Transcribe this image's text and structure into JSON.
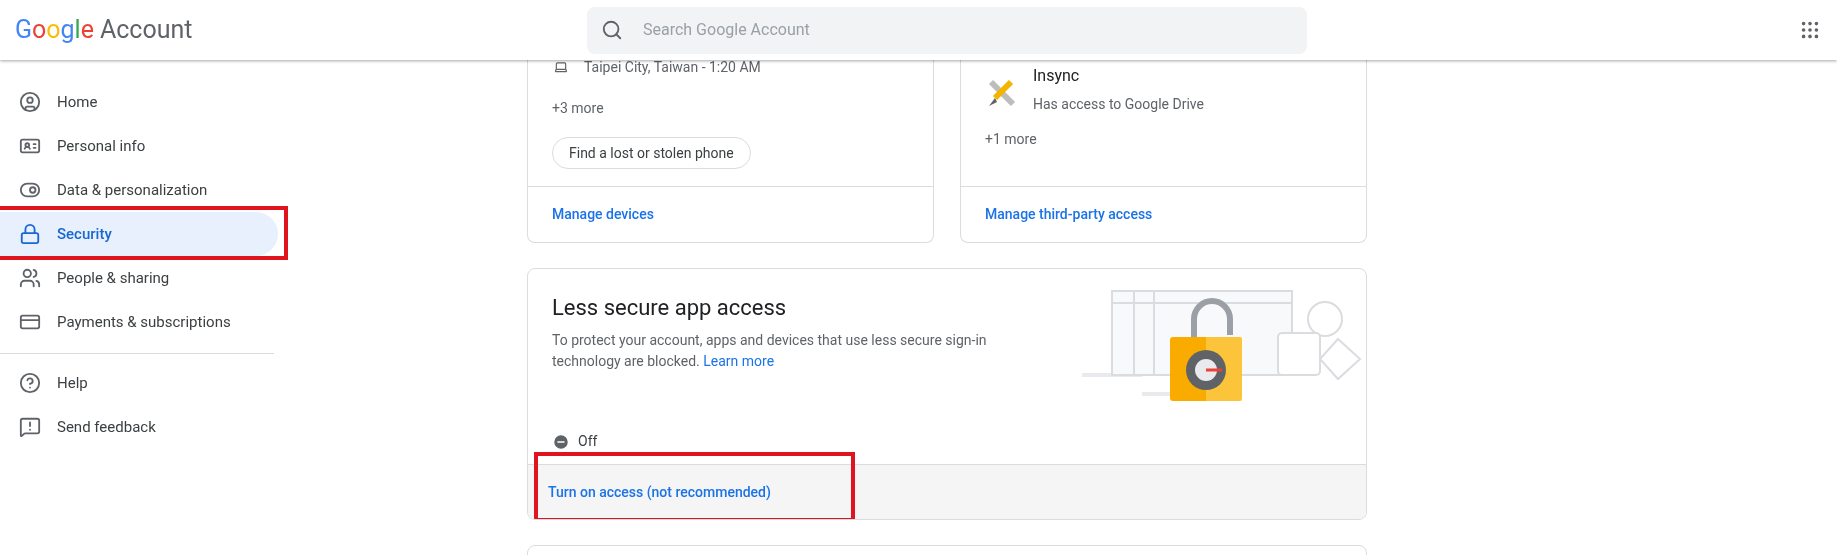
{
  "header": {
    "logo": {
      "brand": "Google",
      "product": "Account"
    },
    "search": {
      "placeholder": "Search Google Account"
    }
  },
  "sidebar": {
    "items": [
      {
        "label": "Home",
        "selected": false,
        "highlighted": false
      },
      {
        "label": "Personal info",
        "selected": false,
        "highlighted": false
      },
      {
        "label": "Data & personalization",
        "selected": false,
        "highlighted": false
      },
      {
        "label": "Security",
        "selected": true,
        "highlighted": true
      },
      {
        "label": "People & sharing",
        "selected": false,
        "highlighted": false
      },
      {
        "label": "Payments & subscriptions",
        "selected": false,
        "highlighted": false
      }
    ],
    "footer_items": [
      {
        "label": "Help"
      },
      {
        "label": "Send feedback"
      }
    ]
  },
  "cards": [
    {
      "kind": "devices",
      "entry": "Taipei City, Taiwan - 1:20 AM",
      "more": "+3 more",
      "button": "Find a lost or stolen phone",
      "link": "Manage devices"
    },
    {
      "kind": "apps",
      "entry": "Insync",
      "detail": "Has access to Google Drive",
      "more": "+1 more",
      "link": "Manage third-party access"
    }
  ],
  "less_secure": {
    "title": "Less secure app access",
    "description": "To protect your account, apps and devices that use less secure sign-in technology are blocked.",
    "learn_more": "Learn more",
    "status": {
      "label": "Off",
      "on": false
    },
    "action": {
      "label": "Turn on access (not recommended)",
      "highlighted": true
    }
  }
}
